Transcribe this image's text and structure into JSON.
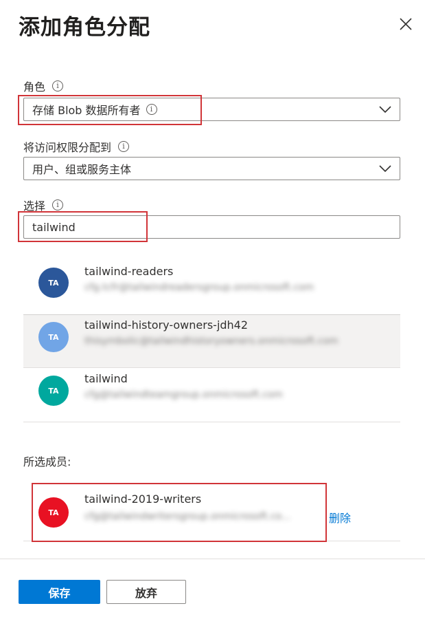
{
  "header": {
    "title": "添加角色分配"
  },
  "role": {
    "label": "角色",
    "value": "存储 Blob 数据所有者"
  },
  "assign_access": {
    "label": "将访问权限分配到",
    "value": "用户、组或服务主体"
  },
  "select": {
    "label": "选择",
    "value": "tailwind"
  },
  "results": [
    {
      "initials": "TA",
      "name": "tailwind-readers",
      "email": "cfg.tcfr@tailwindreadersgroup.onmicrosoft.com",
      "avatar_color": "#2b579a"
    },
    {
      "initials": "TA",
      "name": "tailwind-history-owners-jdh42",
      "email": "thisymbolic@tailwindhistoryowners.onmicrosoft.com",
      "avatar_color": "#71a5e6"
    },
    {
      "initials": "TA",
      "name": "tailwind",
      "email": "cfg@tailwindteamgroup.onmicrosoft.com",
      "avatar_color": "#00a89e"
    }
  ],
  "selected_members": {
    "label": "所选成员:",
    "items": [
      {
        "initials": "TA",
        "name": "tailwind-2019-writers",
        "email": "cfg@tailwindwritersgroup.onmicrosoft.co...",
        "avatar_color": "#e81123",
        "remove_label": "删除"
      }
    ]
  },
  "footer": {
    "save_label": "保存",
    "discard_label": "放弃"
  },
  "colors": {
    "accent": "#0078d4",
    "highlight": "#d13438"
  }
}
